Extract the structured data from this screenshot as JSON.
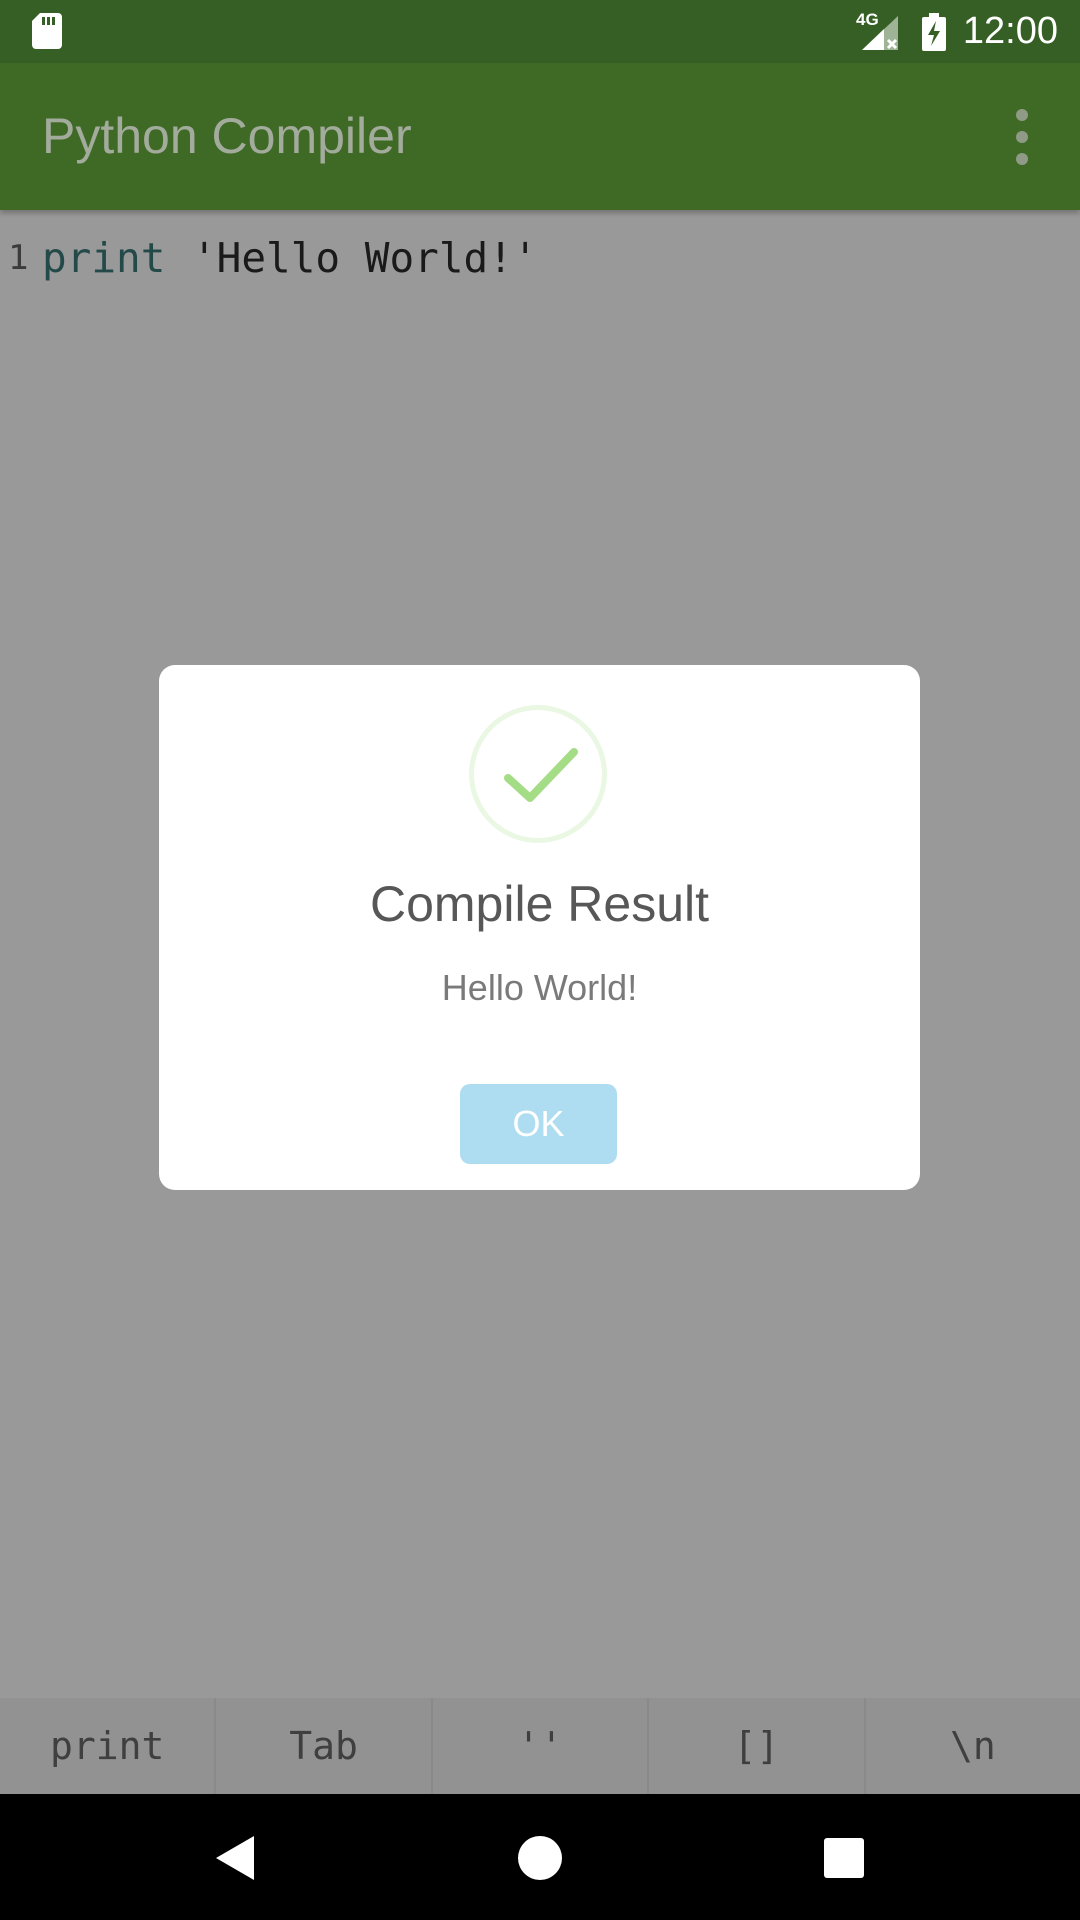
{
  "status_bar": {
    "time": "12:00",
    "network": "4G",
    "icons": [
      "sd-card-icon",
      "cell-signal-icon",
      "battery-charging-icon"
    ]
  },
  "app_bar": {
    "title": "Python Compiler",
    "menu_icon": "overflow-menu-icon"
  },
  "editor": {
    "lines": [
      {
        "number": "1",
        "keyword": "print",
        "string": "'Hello World!'"
      }
    ]
  },
  "shortcut_bar": {
    "keys": [
      "print",
      "Tab",
      "''",
      "[]",
      "\\n"
    ]
  },
  "dialog": {
    "icon": "success-check-icon",
    "title": "Compile Result",
    "message": "Hello World!",
    "ok_label": "OK"
  },
  "nav_bar": {
    "icons": [
      "back-icon",
      "home-icon",
      "recents-icon"
    ]
  },
  "colors": {
    "status_bar": "#355f24",
    "app_bar": "#3e6a26",
    "scrim_background": "#999999",
    "ok_button": "#aedcf0",
    "check_green": "#a5dc86"
  }
}
